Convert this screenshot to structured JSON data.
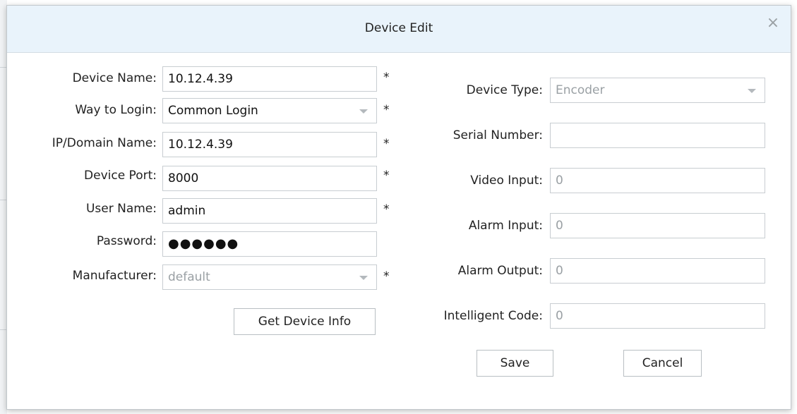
{
  "dialog": {
    "title": "Device Edit",
    "close_glyph": "×"
  },
  "left": {
    "device_name": {
      "label": "Device Name:",
      "value": "10.12.4.39",
      "required": "*"
    },
    "way_to_login": {
      "label": "Way to Login:",
      "value": "Common Login",
      "required": "*"
    },
    "ip_domain": {
      "label": "IP/Domain Name:",
      "value": "10.12.4.39",
      "required": "*"
    },
    "device_port": {
      "label": "Device Port:",
      "value": "8000",
      "required": "*"
    },
    "user_name": {
      "label": "User Name:",
      "value": "admin",
      "required": "*"
    },
    "password": {
      "label": "Password:",
      "value": "●●●●●●"
    },
    "manufacturer": {
      "label": "Manufacturer:",
      "value": "default",
      "required": "*"
    },
    "get_info_button": "Get Device Info"
  },
  "right": {
    "device_type": {
      "label": "Device Type:",
      "value": "Encoder"
    },
    "serial_number": {
      "label": "Serial Number:",
      "value": ""
    },
    "video_input": {
      "label": "Video Input:",
      "value": "0"
    },
    "alarm_input": {
      "label": "Alarm Input:",
      "value": "0"
    },
    "alarm_output": {
      "label": "Alarm Output:",
      "value": "0"
    },
    "intelligent_code": {
      "label": "Intelligent Code:",
      "value": "0"
    }
  },
  "footer": {
    "save_label": "Save",
    "cancel_label": "Cancel"
  }
}
